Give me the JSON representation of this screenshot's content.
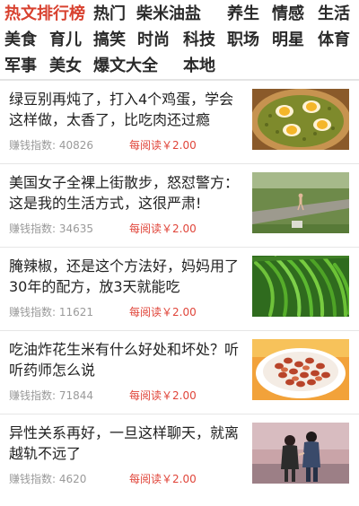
{
  "nav": {
    "rows": [
      [
        "热文排行榜",
        "热门",
        "柴米油盐",
        "养生",
        "情感",
        "生活"
      ],
      [
        "美食",
        "育儿",
        "搞笑",
        "时尚",
        "科技",
        "职场",
        "明星",
        "体育"
      ],
      [
        "军事",
        "美女",
        "爆文大全",
        "本地"
      ]
    ],
    "active": "热文排行榜"
  },
  "articles": [
    {
      "title": "绿豆别再炖了，打入4个鸡蛋，学会这样做，太香了，比吃肉还过瘾",
      "index_label": "赚钱指数:",
      "index_value": "40826",
      "reward": "每阅读￥2.00",
      "image_icon": "eggs-in-pot-image"
    },
    {
      "title": "美国女子全裸上街散步，怒怼警方：这是我的生活方式，这很严肃!",
      "index_label": "赚钱指数:",
      "index_value": "34635",
      "reward": "每阅读￥2.00",
      "image_icon": "woman-walking-road-image"
    },
    {
      "title": "腌辣椒，还是这个方法好，妈妈用了30年的配方，放3天就能吃",
      "index_label": "赚钱指数:",
      "index_value": "11621",
      "reward": "每阅读￥2.00",
      "image_icon": "green-peppers-image"
    },
    {
      "title": "吃油炸花生米有什么好处和坏处？听听药师怎么说",
      "index_label": "赚钱指数:",
      "index_value": "71844",
      "reward": "每阅读￥2.00",
      "image_icon": "fried-peanuts-image"
    },
    {
      "title": "异性关系再好，一旦这样聊天，就离越轨不远了",
      "index_label": "赚钱指数:",
      "index_value": "4620",
      "reward": "每阅读￥2.00",
      "image_icon": "couple-walking-image"
    }
  ],
  "colors": {
    "accent": "#d8412f",
    "reward": "#e0453a",
    "muted": "#9a9a9a"
  }
}
